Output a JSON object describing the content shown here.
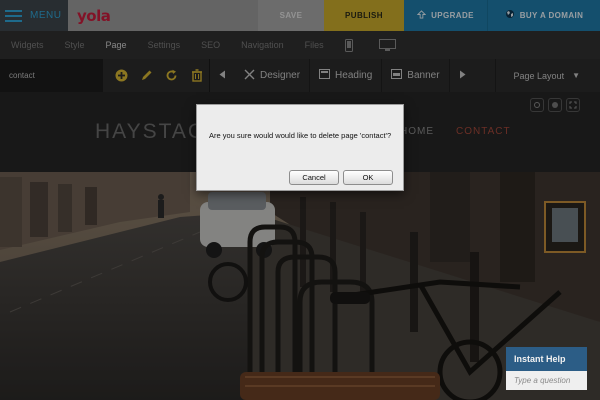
{
  "topbar": {
    "menu_label": "MENU",
    "logo_text": "yola",
    "save_label": "SAVE",
    "publish_label": "PUBLISH",
    "upgrade_label": "UPGRADE",
    "buy_label": "BUY A DOMAIN"
  },
  "nav": {
    "tabs": [
      {
        "label": "Widgets",
        "active": false
      },
      {
        "label": "Style",
        "active": false
      },
      {
        "label": "Page",
        "active": true
      },
      {
        "label": "Settings",
        "active": false
      },
      {
        "label": "SEO",
        "active": false
      },
      {
        "label": "Navigation",
        "active": false
      },
      {
        "label": "Files",
        "active": false
      }
    ],
    "device_icons": [
      "mobile-icon",
      "desktop-icon"
    ]
  },
  "toolbar": {
    "page_name": "contact",
    "icons": [
      "add-icon",
      "pencil-icon",
      "refresh-icon",
      "trash-icon"
    ],
    "designer_label": "Designer",
    "heading_label": "Heading",
    "banner_label": "Banner",
    "page_layout_label": "Page Layout"
  },
  "site": {
    "title": "HAYSTAC",
    "nav_home": "HOME",
    "nav_contact": "CONTACT"
  },
  "dialog": {
    "message": "Are you sure would would like to delete page 'contact'?",
    "cancel_label": "Cancel",
    "ok_label": "OK"
  },
  "help": {
    "title": "Instant Help",
    "placeholder": "Type a question"
  },
  "colors": {
    "accent_blue": "#1f7aa8",
    "publish_yellow": "#c9ab2c",
    "logo_red": "#c81d3c",
    "contact_red": "#a4483a",
    "help_blue": "#2c5d86"
  }
}
